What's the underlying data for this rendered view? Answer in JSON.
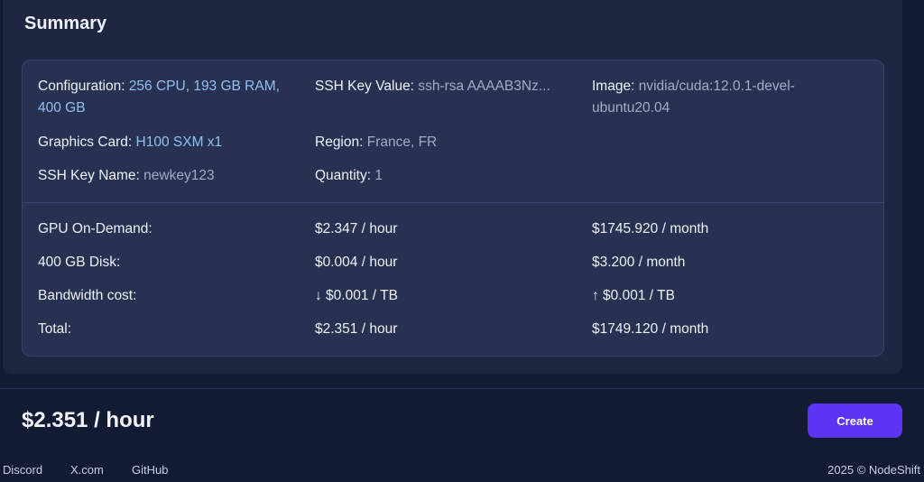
{
  "summary": {
    "title": "Summary",
    "config": {
      "configuration_label": "Configuration: ",
      "configuration_value_line1": "256 CPU, 193 GB RAM,",
      "configuration_value_line2": "400 GB",
      "ssh_key_value_label": "SSH Key Value: ",
      "ssh_key_value": "ssh-rsa AAAAB3Nz...",
      "image_label": "Image: ",
      "image_value_line1": "nvidia/cuda:12.0.1-devel-",
      "image_value_line2": "ubuntu20.04",
      "graphics_card_label": "Graphics Card: ",
      "graphics_card_value": "H100 SXM x1",
      "region_label": "Region: ",
      "region_value": "France, FR",
      "ssh_key_name_label": "SSH Key Name: ",
      "ssh_key_name_value": "newkey123",
      "quantity_label": "Quantity: ",
      "quantity_value": "1"
    },
    "costs": [
      {
        "label": "GPU On-Demand:",
        "hourly": "$2.347 / hour",
        "monthly": "$1745.920 / month"
      },
      {
        "label": "400 GB Disk:",
        "hourly": "$0.004 / hour",
        "monthly": "$3.200 / month"
      },
      {
        "label": "Bandwidth cost:",
        "hourly": "↓ $0.001 / TB",
        "monthly": "↑ $0.001 / TB"
      },
      {
        "label": "Total:",
        "hourly": "$2.351 / hour",
        "monthly": "$1749.120 / month"
      }
    ]
  },
  "footer": {
    "total_price": "$2.351 / hour",
    "create_label": "Create",
    "links": [
      "Discord",
      "X.com",
      "GitHub"
    ],
    "copyright": "2025 © NodeShift"
  },
  "colors": {
    "accent_button": "#5b35f2",
    "accent_value": "#8fc0f0"
  }
}
